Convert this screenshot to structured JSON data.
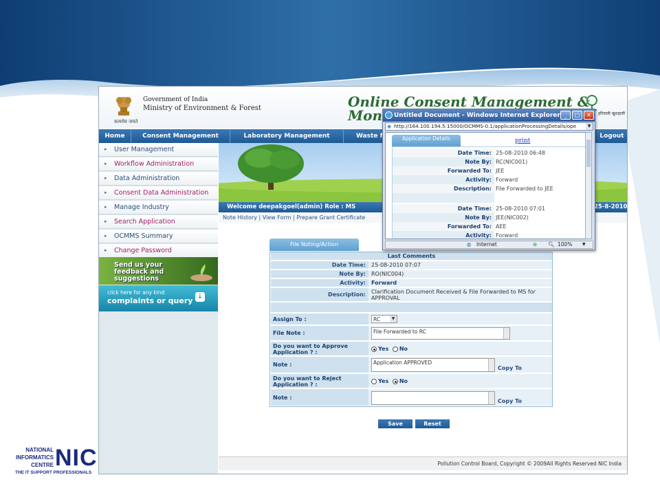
{
  "header": {
    "gov_line": "Government of India",
    "ministry": "Ministry of Environment & Forest",
    "emblem_caption": "सत्यमेव जयते",
    "app_title_line1": "Online Consent Management &",
    "app_title_line2": "Moni",
    "right_logo_text": "हरियाली खुशहाली"
  },
  "topnav": [
    "Home",
    "Consent Management",
    "Laboratory Management",
    "Waste M",
    "Logout"
  ],
  "sidebar": {
    "items": [
      {
        "label": "User Management",
        "color": "#2a4d7a"
      },
      {
        "label": "Workflow Administration",
        "color": "#a0206a"
      },
      {
        "label": "Data Administration",
        "color": "#2a4d7a"
      },
      {
        "label": "Consent Data Administration",
        "color": "#a0206a"
      },
      {
        "label": "Manage Industry",
        "color": "#2a4d7a"
      },
      {
        "label": "Search Application",
        "color": "#a0206a"
      },
      {
        "label": "OCMMS Summary",
        "color": "#2a4d7a"
      },
      {
        "label": "Change Password",
        "color": "#a0206a"
      }
    ],
    "feedback_banner": "Send us your feedback and suggestions",
    "complaints_line1": "click here for any kind",
    "complaints_line2": "complaints or query"
  },
  "welcome": {
    "text": "Welcome deepakgoel(admin)    Role : MS",
    "date": "25-8-2010"
  },
  "sublinks": [
    "Note History",
    "View Form",
    "Prepare Grant Certificate"
  ],
  "form": {
    "tab": "File Noting/Action",
    "last_comments_header": "Last Comments",
    "last": {
      "date_time_label": "Date Time:",
      "date_time": "25-08-2010 07:07",
      "note_by_label": "Note By:",
      "note_by": "RO(NIC004)",
      "activity_label": "Activity:",
      "activity": "Forward",
      "description_label": "Description:",
      "description": "Clarification Document Received & File Forwarded to MS for APPROVAL"
    },
    "assign_to_label": "Assign To :",
    "assign_to_value": "RC",
    "file_note_label": "File Note :",
    "file_note_value": "File Forwarded to RC",
    "approve_label": "Do you want to Approve Application ? :",
    "yes": "Yes",
    "no": "No",
    "note_label": "Note :",
    "approve_note_value": "Application APPROVED",
    "copy_to": "Copy To",
    "reject_label": "Do you want to Reject Application ? :",
    "reject_note_value": "",
    "save": "Save",
    "reset": "Reset"
  },
  "footer": "Pollution Control Board, Copyright © 2009All Rights Reserved NIC India",
  "popup": {
    "title": "Untitled Document - Windows Internet Explorer",
    "address": "http://164.100.194.5:15000/OCMMS-0.1/applicationProcessingDetails/ope",
    "tab": "Application Details",
    "print": "print",
    "records": [
      {
        "date_time": "25-08-2010 06:48",
        "note_by": "RC(NIC001)",
        "forwarded_to": "JEE",
        "activity": "Forward",
        "description": "File Forwarded to JEE"
      },
      {
        "date_time": "25-08-2010 07:01",
        "note_by": "JEE(NIC002)",
        "forwarded_to": "AEE",
        "activity": "Forward"
      }
    ],
    "labels": {
      "date_time": "Date Time:",
      "note_by": "Note By:",
      "forwarded_to": "Forwarded To:",
      "activity": "Activity:",
      "description": "Description:"
    },
    "status_zone": "Internet",
    "zoom": "100%"
  },
  "nic": {
    "line1": "NATIONAL",
    "line2": "INFORMATICS",
    "line3": "CENTRE",
    "big": "NIC",
    "tagline": "THE IT SUPPORT PROFESSIONALS"
  }
}
